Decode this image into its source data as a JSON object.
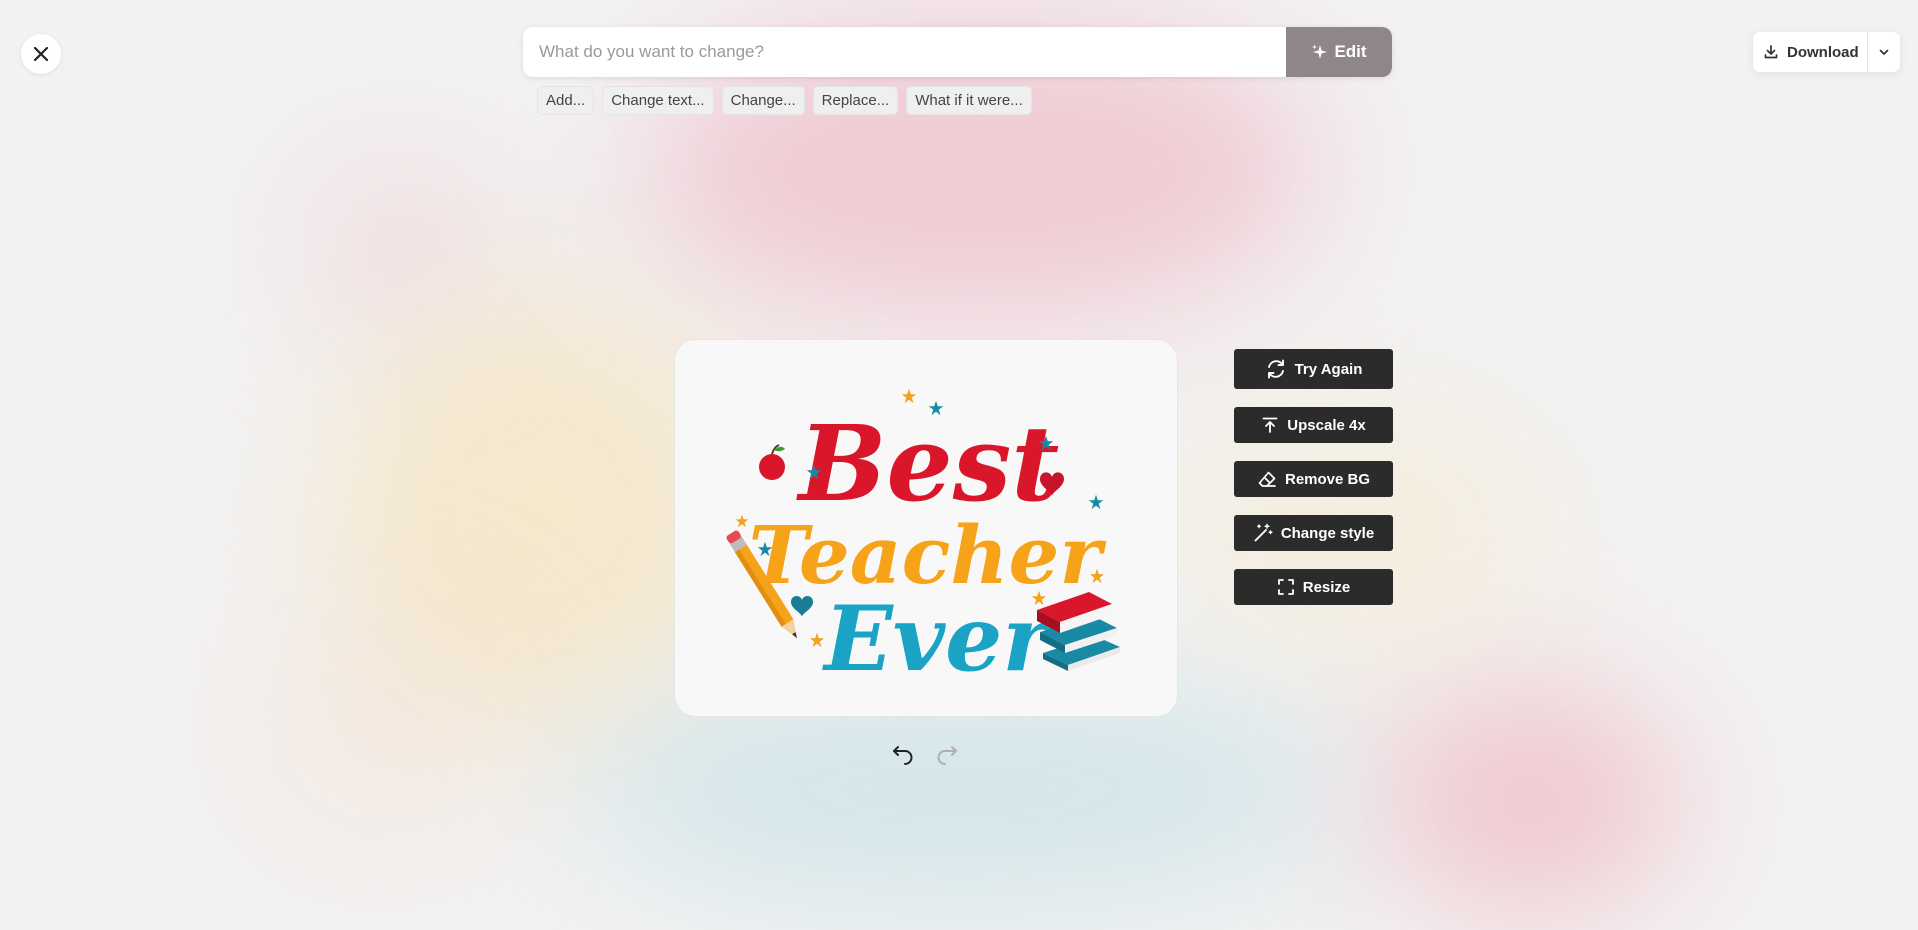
{
  "prompt": {
    "placeholder": "What do you want to change?",
    "value": "",
    "edit_label": "Edit"
  },
  "suggestions": [
    "Add...",
    "Change text...",
    "Change...",
    "Replace...",
    "What if it were..."
  ],
  "download": {
    "label": "Download"
  },
  "actions": [
    {
      "label": "Try Again",
      "icon": "refresh-icon"
    },
    {
      "label": "Upscale 4x",
      "icon": "upscale-icon"
    },
    {
      "label": "Remove BG",
      "icon": "eraser-icon"
    },
    {
      "label": "Change style",
      "icon": "magic-wand-icon"
    },
    {
      "label": "Resize",
      "icon": "resize-icon"
    }
  ],
  "image": {
    "words": [
      "Best",
      "Teacher",
      "Ever"
    ],
    "colors": {
      "best": "#d9162a",
      "teacher": "#f6a31a",
      "ever": "#1aa3c4",
      "star_blue": "#1a8aa4",
      "star_orange": "#f2a21b"
    }
  },
  "history": {
    "undo_enabled": true,
    "redo_enabled": false
  }
}
